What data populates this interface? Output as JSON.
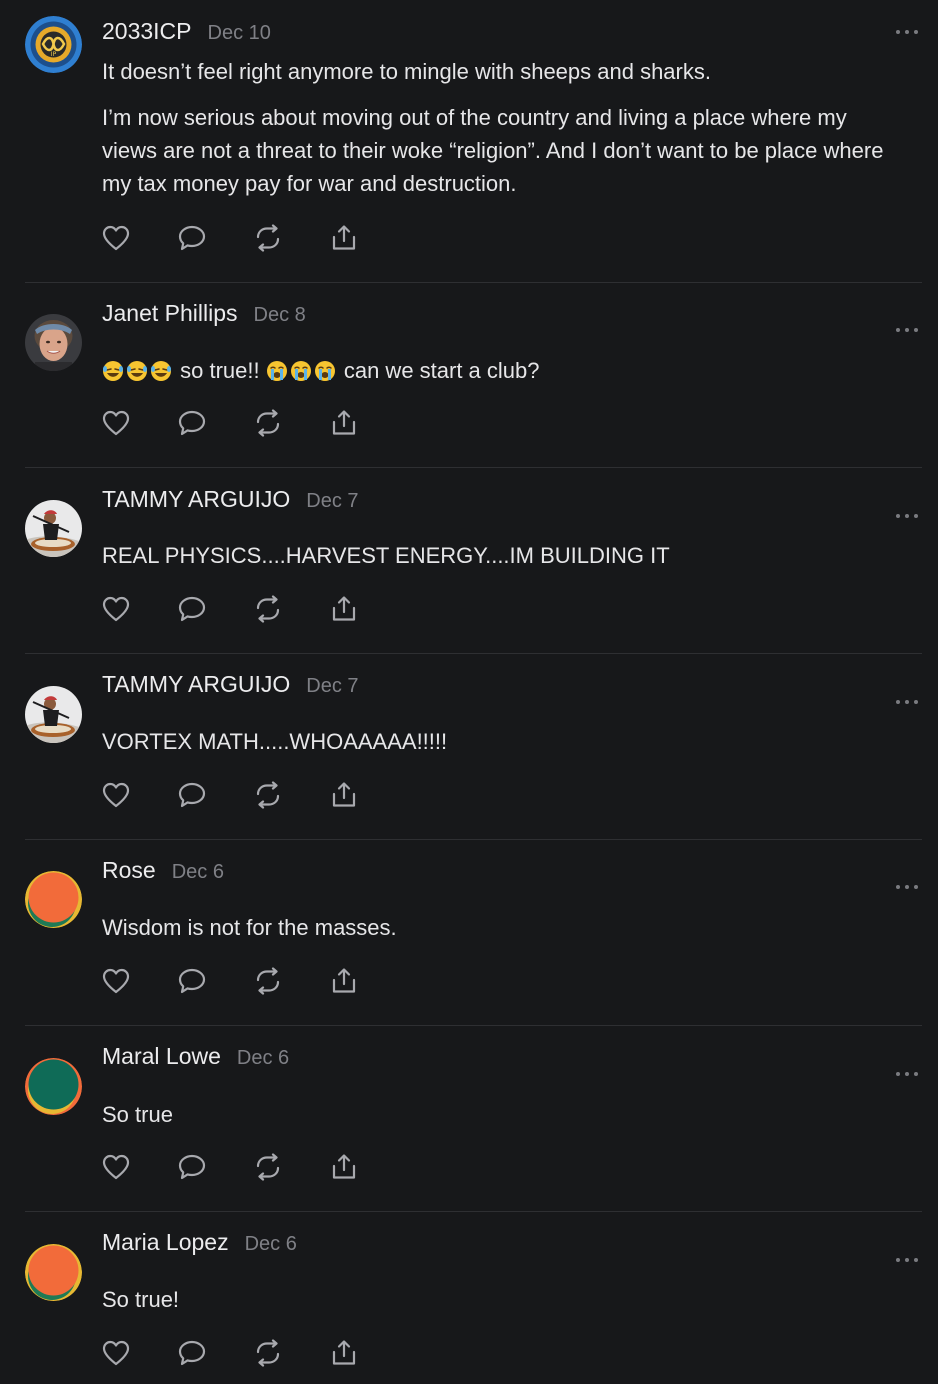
{
  "comments": [
    {
      "author": "2033ICP",
      "date": "Dec 10",
      "paragraphs": [
        "It doesn’t feel right anymore to mingle with sheeps and sharks.",
        "I’m now serious about moving out of the country and living a place where my views are not a threat to their woke “religion”. And I don’t want to be place where my tax money pay for war and destruction."
      ],
      "avatar_label": "IP"
    },
    {
      "author": "Janet Phillips",
      "date": "Dec 8",
      "text_prefix_emoji": "rolling-on-floor-laughing x3",
      "text_middle": " so true!! ",
      "text_middle_emoji": "loudly-crying x3",
      "text_suffix": " can we start a club?"
    },
    {
      "author": "TAMMY ARGUIJO",
      "date": "Dec 7",
      "text": "REAL PHYSICS....HARVEST ENERGY....IM BUILDING IT"
    },
    {
      "author": "TAMMY ARGUIJO",
      "date": "Dec 7",
      "text": "VORTEX MATH.....WHOAAAAA!!!!!"
    },
    {
      "author": "Rose",
      "date": "Dec 6",
      "text": "Wisdom is not for the masses."
    },
    {
      "author": "Maral Lowe",
      "date": "Dec 6",
      "text": "So true"
    },
    {
      "author": "Maria Lopez",
      "date": "Dec 6",
      "text": "So true!"
    }
  ],
  "icons": {
    "like": "heart-icon",
    "reply": "comment-bubble-icon",
    "repost": "repost-arrows-icon",
    "share": "share-upload-icon",
    "more": "more-dots-icon"
  },
  "colors": {
    "background": "#17181a",
    "text": "#e8e8ea",
    "muted": "#7f8086",
    "icon": "#a8a9ae",
    "divider": "#2e2f32",
    "rose_avatar": "#f26b3a",
    "maral_avatar": "#0f6b57"
  }
}
